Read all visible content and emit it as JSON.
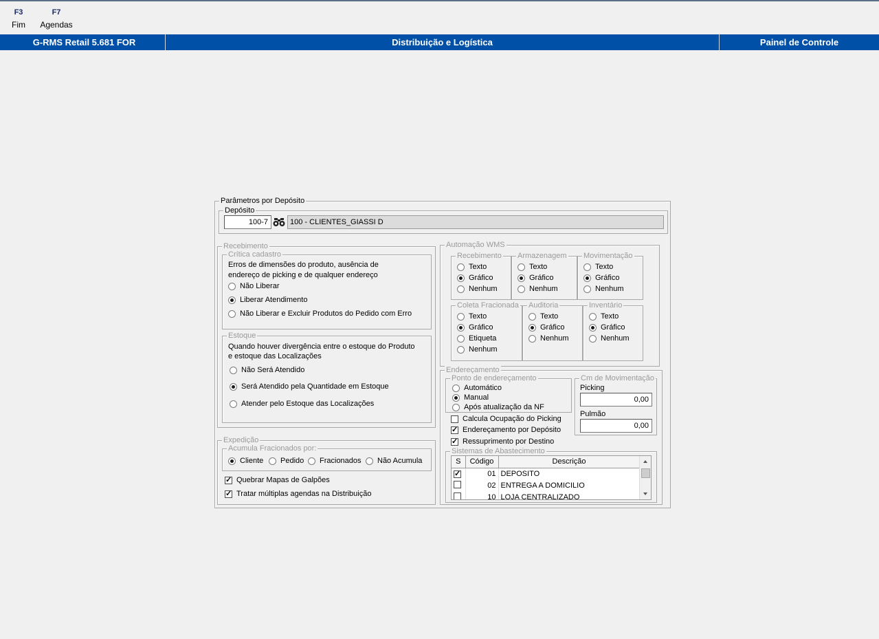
{
  "toolbar": {
    "f3_key": "F3",
    "f3_label": "Fim",
    "f7_key": "F7",
    "f7_label": "Agendas"
  },
  "header": {
    "app": "G-RMS Retail 5.681 FOR",
    "module": "Distribuição e Logística",
    "screen": "Painel de Controle"
  },
  "params": {
    "title": "Parâmetros por Depósito",
    "deposito": {
      "title": "Depósito",
      "code": "100-7",
      "name": "100 - CLIENTES_GIASSI D"
    },
    "recebimento": {
      "title": "Recebimento",
      "critica": {
        "title": "Crítica cadastro",
        "desc1": "Erros de dimensões do produto, ausência de",
        "desc2": "endereço de picking e de qualquer endereço",
        "options": [
          "Não Liberar",
          "Liberar Atendimento",
          "Não Liberar e Excluir Produtos do Pedido com Erro"
        ],
        "selected": 1
      },
      "estoque": {
        "title": "Estoque",
        "desc1": "Quando houver divergência entre o estoque do Produto",
        "desc2": "e estoque das Localizações",
        "options": [
          "Não Será Atendido",
          "Será Atendido pela Quantidade em Estoque",
          "Atender pelo Estoque das Localizações"
        ],
        "selected": 1
      }
    },
    "expedicao": {
      "title": "Expedição",
      "acumula": {
        "title": "Acumula Fracionados por:",
        "options": [
          "Cliente",
          "Pedido",
          "Fracionados",
          "Não Acumula"
        ],
        "selected": 0
      },
      "quebrar_mapas": {
        "label": "Quebrar Mapas de Galpões",
        "checked": true
      },
      "multiplas_agendas": {
        "label": "Tratar múltiplas agendas na Distribuição",
        "checked": true
      }
    },
    "automacao": {
      "title": "Automação WMS",
      "recebimento": {
        "title": "Recebimento",
        "options": [
          "Texto",
          "Gráfico",
          "Nenhum"
        ],
        "selected": 1
      },
      "armazenagem": {
        "title": "Armazenagem",
        "options": [
          "Texto",
          "Gráfico",
          "Nenhum"
        ],
        "selected": 1
      },
      "movimentacao": {
        "title": "Movimentação",
        "options": [
          "Texto",
          "Gráfico",
          "Nenhum"
        ],
        "selected": 1
      },
      "coleta": {
        "title": "Coleta Fracionada",
        "options": [
          "Texto",
          "Gráfico",
          "Etiqueta",
          "Nenhum"
        ],
        "selected": 1
      },
      "auditoria": {
        "title": "Auditoria",
        "options": [
          "Texto",
          "Gráfico",
          "Nenhum"
        ],
        "selected": 1
      },
      "inventario": {
        "title": "Inventário",
        "options": [
          "Texto",
          "Gráfico",
          "Nenhum"
        ],
        "selected": 1
      }
    },
    "enderecamento": {
      "title": "Endereçamento",
      "ponto": {
        "title": "Ponto de endereçamento",
        "options": [
          "Automático",
          "Manual",
          "Após atualização da NF"
        ],
        "selected": 1
      },
      "cm": {
        "title": "Cm de Movimentação",
        "picking_label": "Picking",
        "picking_value": "0,00",
        "pulmao_label": "Pulmão",
        "pulmao_value": "0,00"
      },
      "calcula_ocupacao": {
        "label": "Calcula Ocupação do Picking",
        "checked": false
      },
      "end_por_deposito": {
        "label": "Endereçamento por Depósito",
        "checked": true
      },
      "ressuprimento": {
        "label": "Ressuprimento por Destino",
        "checked": true
      },
      "sistemas": {
        "title": "Sistemas de Abastecimento",
        "columns": [
          "S",
          "Código",
          "Descrição"
        ],
        "rows": [
          {
            "checked": true,
            "codigo": "01",
            "descricao": "DEPOSITO"
          },
          {
            "checked": false,
            "codigo": "02",
            "descricao": "ENTREGA A DOMICILIO"
          },
          {
            "checked": false,
            "codigo": "10",
            "descricao": "LOJA CENTRALIZADO"
          }
        ]
      }
    }
  }
}
